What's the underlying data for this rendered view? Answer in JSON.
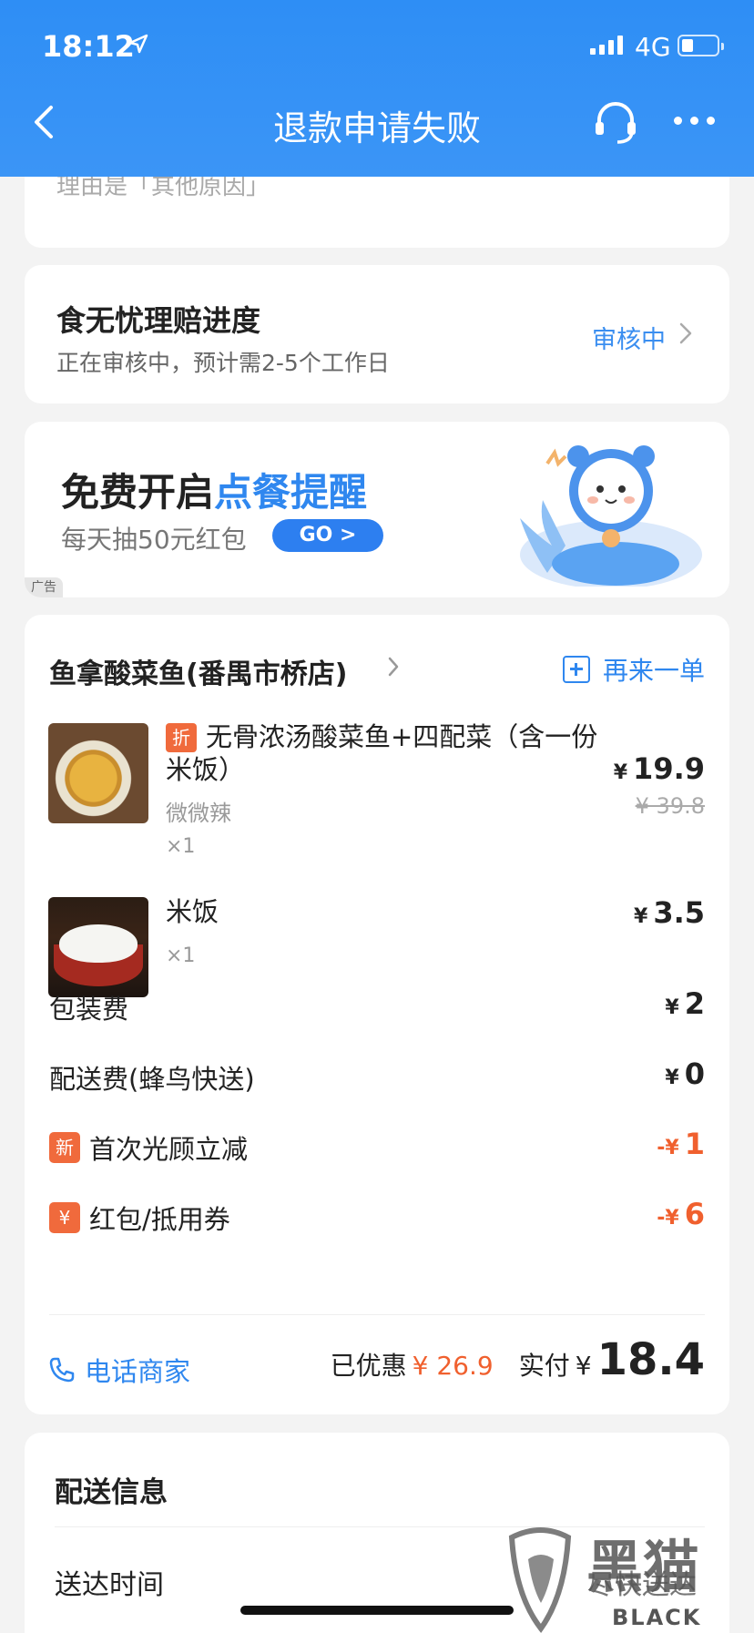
{
  "status_bar": {
    "time": "18:12",
    "network": "4G"
  },
  "nav": {
    "title": "退款申请失败"
  },
  "top_card": {
    "text": "理由是「其他原因」"
  },
  "claim": {
    "title": "食无忧理赔进度",
    "subtitle": "正在审核中，预计需2-5个工作日",
    "status": "审核中"
  },
  "ad": {
    "title_prefix": "免费开启",
    "title_highlight": "点餐提醒",
    "subtitle": "每天抽50元红包",
    "go_label": "GO >",
    "tag": "广告"
  },
  "order": {
    "store_name": "鱼拿酸菜鱼(番禺市桥店)",
    "reorder_label": "再来一单",
    "items": [
      {
        "badge": "折",
        "name": "无骨浓汤酸菜鱼+四配菜（含一份米饭）",
        "spec": "微微辣",
        "qty": "×1",
        "currency": "¥",
        "price": "19.9",
        "original_price": "¥ 39.8"
      },
      {
        "name": "米饭",
        "qty": "×1",
        "currency": "¥",
        "price": "3.5"
      }
    ],
    "fees": [
      {
        "label": "包装费",
        "currency": "¥",
        "value": "2"
      },
      {
        "label": "配送费(蜂鸟快送)",
        "currency": "¥",
        "value": "0"
      },
      {
        "badge": "新",
        "label": "首次光顾立减",
        "currency": "-¥",
        "value": "1",
        "highlight": true
      },
      {
        "badge": "¥",
        "label": "红包/抵用券",
        "currency": "-¥",
        "value": "6",
        "highlight": true
      }
    ],
    "call_label": "电话商家",
    "saved_label": "已优惠",
    "saved_value": "¥ 26.9",
    "paid_label": "实付",
    "paid_currency": "¥",
    "paid_value": "18.4"
  },
  "delivery": {
    "title": "配送信息",
    "time_label": "送达时间",
    "time_value": "尽快送达"
  },
  "watermark": {
    "text": "BLACK CAT"
  },
  "colors": {
    "brand_blue": "#2f87ef",
    "discount_orange": "#f0602e"
  }
}
